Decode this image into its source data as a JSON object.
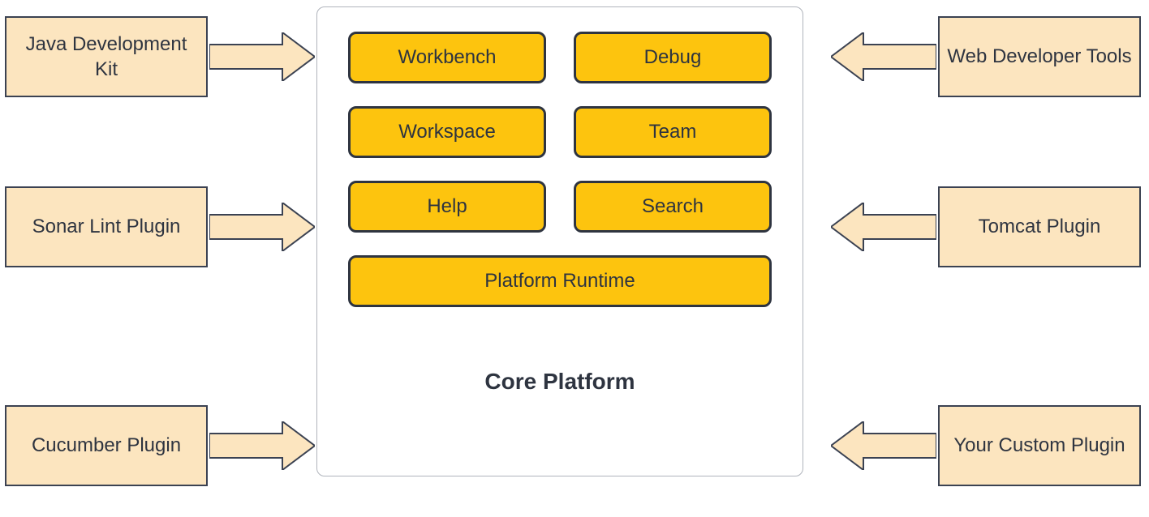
{
  "leftPlugins": [
    {
      "label": "Java Development Kit"
    },
    {
      "label": "Sonar Lint Plugin"
    },
    {
      "label": "Cucumber Plugin"
    }
  ],
  "rightPlugins": [
    {
      "label": "Web Developer Tools"
    },
    {
      "label": "Tomcat Plugin"
    },
    {
      "label": "Your Custom Plugin"
    }
  ],
  "core": {
    "title": "Core Platform",
    "modules": [
      "Workbench",
      "Debug",
      "Workspace",
      "Team",
      "Help",
      "Search"
    ],
    "runtime": "Platform Runtime"
  },
  "colors": {
    "pluginFill": "#fce5bf",
    "coreFill": "#fdc40e",
    "stroke": "#2e3440"
  }
}
